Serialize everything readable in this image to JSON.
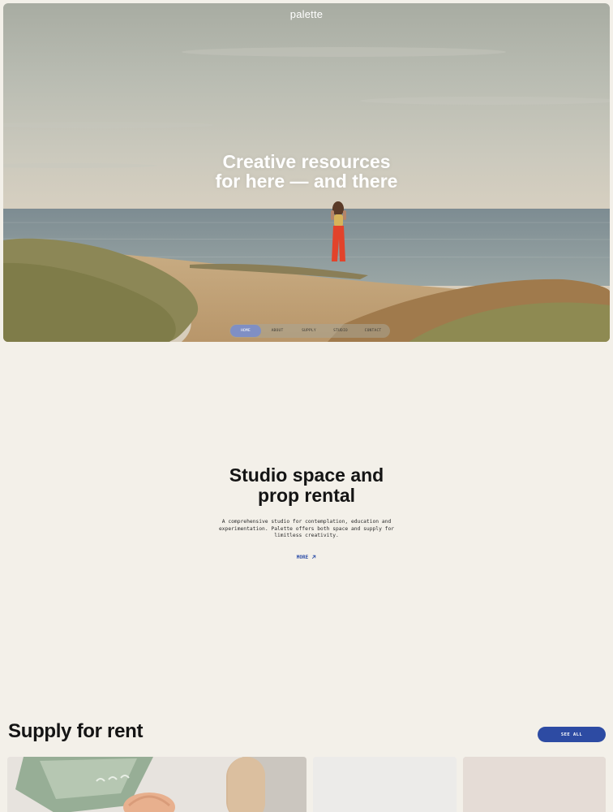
{
  "site": {
    "brand": "palette"
  },
  "hero": {
    "title_line1": "Creative resources",
    "title_line2": "for here — and there"
  },
  "nav": {
    "items": [
      {
        "label": "HOME",
        "active": true
      },
      {
        "label": "ABOUT",
        "active": false
      },
      {
        "label": "SUPPLY",
        "active": false
      },
      {
        "label": "STUDIO",
        "active": false
      },
      {
        "label": "CONTACT",
        "active": false
      }
    ]
  },
  "intro": {
    "title_line1": "Studio space and",
    "title_line2": "prop rental",
    "text": "A comprehensive studio for contemplation, education and experimentation. Palette offers both space and supply for limitless creativity.",
    "more_label": "MORE"
  },
  "supply": {
    "title": "Supply for rent",
    "see_all_label": "SEE ALL"
  },
  "colors": {
    "accent_blue": "#2d4ba3",
    "nav_active": "#7f8fc4",
    "page_background": "#f3f0e9"
  },
  "icons": {
    "more": "arrow-up-right-icon"
  }
}
